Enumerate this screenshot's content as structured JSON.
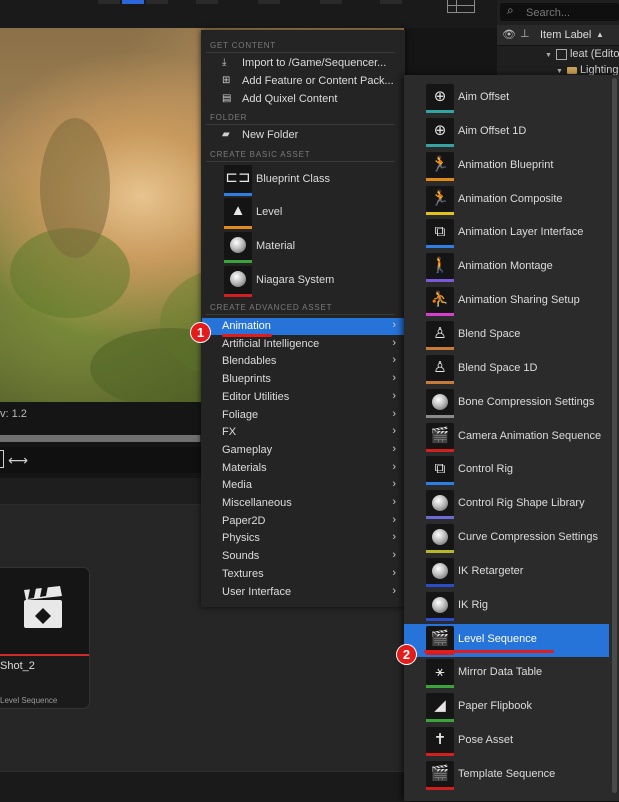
{
  "outliner": {
    "search_placeholder": "Search...",
    "column_label": "Item Label",
    "rows": [
      {
        "label": "leat (Edito"
      },
      {
        "label": "Lighting"
      }
    ]
  },
  "viewport": {
    "label": "v: 1.2"
  },
  "content_browser": {
    "tile_name": "Shot_2",
    "tile_type": "Level Sequence"
  },
  "add_menu": {
    "sections": {
      "get_content": "GET CONTENT",
      "folder": "FOLDER",
      "create_basic": "CREATE BASIC ASSET",
      "create_advanced": "CREATE ADVANCED ASSET"
    },
    "get_content_items": [
      {
        "label": "Import to /Game/Sequencer...",
        "icon": "import-icon"
      },
      {
        "label": "Add Feature or Content Pack...",
        "icon": "add-feature-icon"
      },
      {
        "label": "Add Quixel Content",
        "icon": "quixel-icon"
      }
    ],
    "folder_items": [
      {
        "label": "New Folder",
        "icon": "new-folder-icon"
      }
    ],
    "basic_assets": [
      {
        "label": "Blueprint Class",
        "color": "#2f7ee3"
      },
      {
        "label": "Level",
        "color": "#e08a1c"
      },
      {
        "label": "Material",
        "color": "#3aa33a"
      },
      {
        "label": "Niagara System",
        "color": "#d11f1f"
      }
    ],
    "categories": [
      "Animation",
      "Artificial Intelligence",
      "Blendables",
      "Blueprints",
      "Editor Utilities",
      "Foliage",
      "FX",
      "Gameplay",
      "Materials",
      "Media",
      "Miscellaneous",
      "Paper2D",
      "Physics",
      "Sounds",
      "Textures",
      "User Interface"
    ],
    "selected_category": "Animation"
  },
  "animation_submenu": {
    "items": [
      {
        "label": "Aim Offset",
        "color": "#36a3a3",
        "icon": "crosshair-icon"
      },
      {
        "label": "Aim Offset 1D",
        "color": "#36a3a3",
        "icon": "crosshair-icon"
      },
      {
        "label": "Animation Blueprint",
        "color": "#e08a1c",
        "icon": "running-figure-icon"
      },
      {
        "label": "Animation Composite",
        "color": "#e2c21c",
        "icon": "running-figure-icon"
      },
      {
        "label": "Animation Layer Interface",
        "color": "#2f7ee3",
        "icon": "node-graph-icon"
      },
      {
        "label": "Animation Montage",
        "color": "#7a5ad8",
        "icon": "montage-figure-icon"
      },
      {
        "label": "Animation Sharing Setup",
        "color": "#d53fd0",
        "icon": "sharing-figure-icon"
      },
      {
        "label": "Blend Space",
        "color": "#c77a3a",
        "icon": "blend-figure-icon"
      },
      {
        "label": "Blend Space 1D",
        "color": "#c77a3a",
        "icon": "blend-figure-icon"
      },
      {
        "label": "Bone Compression Settings",
        "color": "#8a8a8a",
        "icon": "sphere-icon"
      },
      {
        "label": "Camera Animation Sequence",
        "color": "#d11f1f",
        "icon": "clapperboard-icon"
      },
      {
        "label": "Control Rig",
        "color": "#2f7ee3",
        "icon": "node-graph-icon"
      },
      {
        "label": "Control Rig Shape Library",
        "color": "#6b6bd8",
        "icon": "sphere-icon"
      },
      {
        "label": "Curve Compression Settings",
        "color": "#b7b72c",
        "icon": "sphere-icon"
      },
      {
        "label": "IK Retargeter",
        "color": "#2a4cc9",
        "icon": "sphere-icon"
      },
      {
        "label": "IK Rig",
        "color": "#2a4cc9",
        "icon": "sphere-icon"
      },
      {
        "label": "Level Sequence",
        "color": "#d11f1f",
        "icon": "clapperboard-icon"
      },
      {
        "label": "Mirror Data Table",
        "color": "#3aa33a",
        "icon": "mirror-figure-icon"
      },
      {
        "label": "Paper Flipbook",
        "color": "#3aa33a",
        "icon": "flipbook-icon"
      },
      {
        "label": "Pose Asset",
        "color": "#d11f1f",
        "icon": "pose-figure-icon"
      },
      {
        "label": "Template Sequence",
        "color": "#d11f1f",
        "icon": "clapperboard-icon"
      }
    ],
    "selected": "Level Sequence"
  },
  "callouts": [
    "1",
    "2"
  ],
  "colors": {
    "selection": "#2673d9",
    "callout": "#e21b1b"
  }
}
